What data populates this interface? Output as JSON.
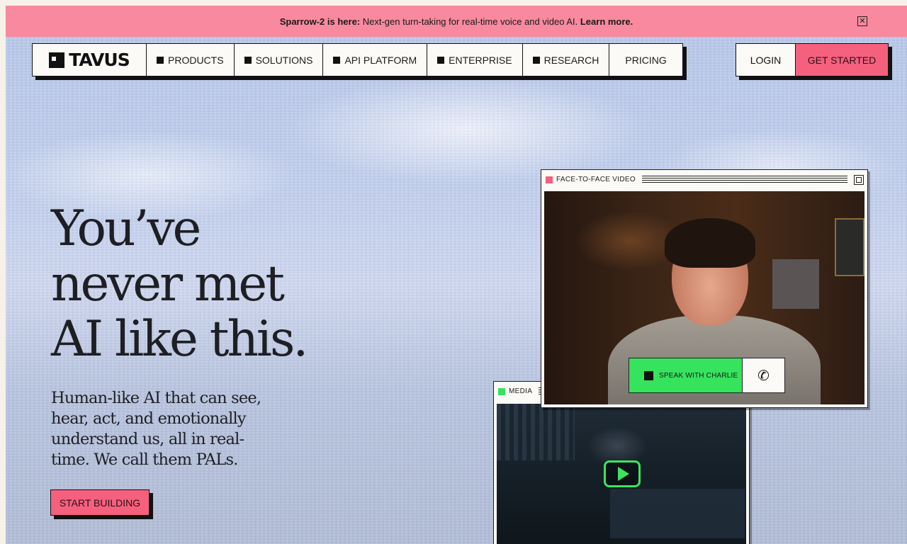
{
  "banner": {
    "bold": "Sparrow-2 is here:",
    "text": " Next-gen turn-taking for real-time voice and video AI. ",
    "link": "Learn more."
  },
  "nav": {
    "logo": "TAVUS",
    "items": [
      {
        "label": "PRODUCTS"
      },
      {
        "label": "SOLUTIONS"
      },
      {
        "label": "API PLATFORM"
      },
      {
        "label": "ENTERPRISE"
      },
      {
        "label": "RESEARCH"
      },
      {
        "label": "PRICING"
      }
    ],
    "login": "LOGIN",
    "get_started": "GET STARTED"
  },
  "hero": {
    "title_lines": [
      "You’ve",
      "never met",
      "AI like this."
    ],
    "subtitle": "Human-like AI that can see, hear, act, and emotionally understand us, all in real-time. We call them PALs.",
    "cta": "START BUILDING"
  },
  "windows": {
    "f2f": {
      "label": "FACE-TO-FACE VIDEO",
      "dot_color": "#f5607e",
      "speak_label": "SPEAK WITH CHARLIE"
    },
    "media": {
      "label": "MEDIA",
      "dot_color": "#35e35c"
    }
  },
  "colors": {
    "banner": "#f8899e",
    "accent": "#f5607e",
    "green": "#35e35c"
  }
}
